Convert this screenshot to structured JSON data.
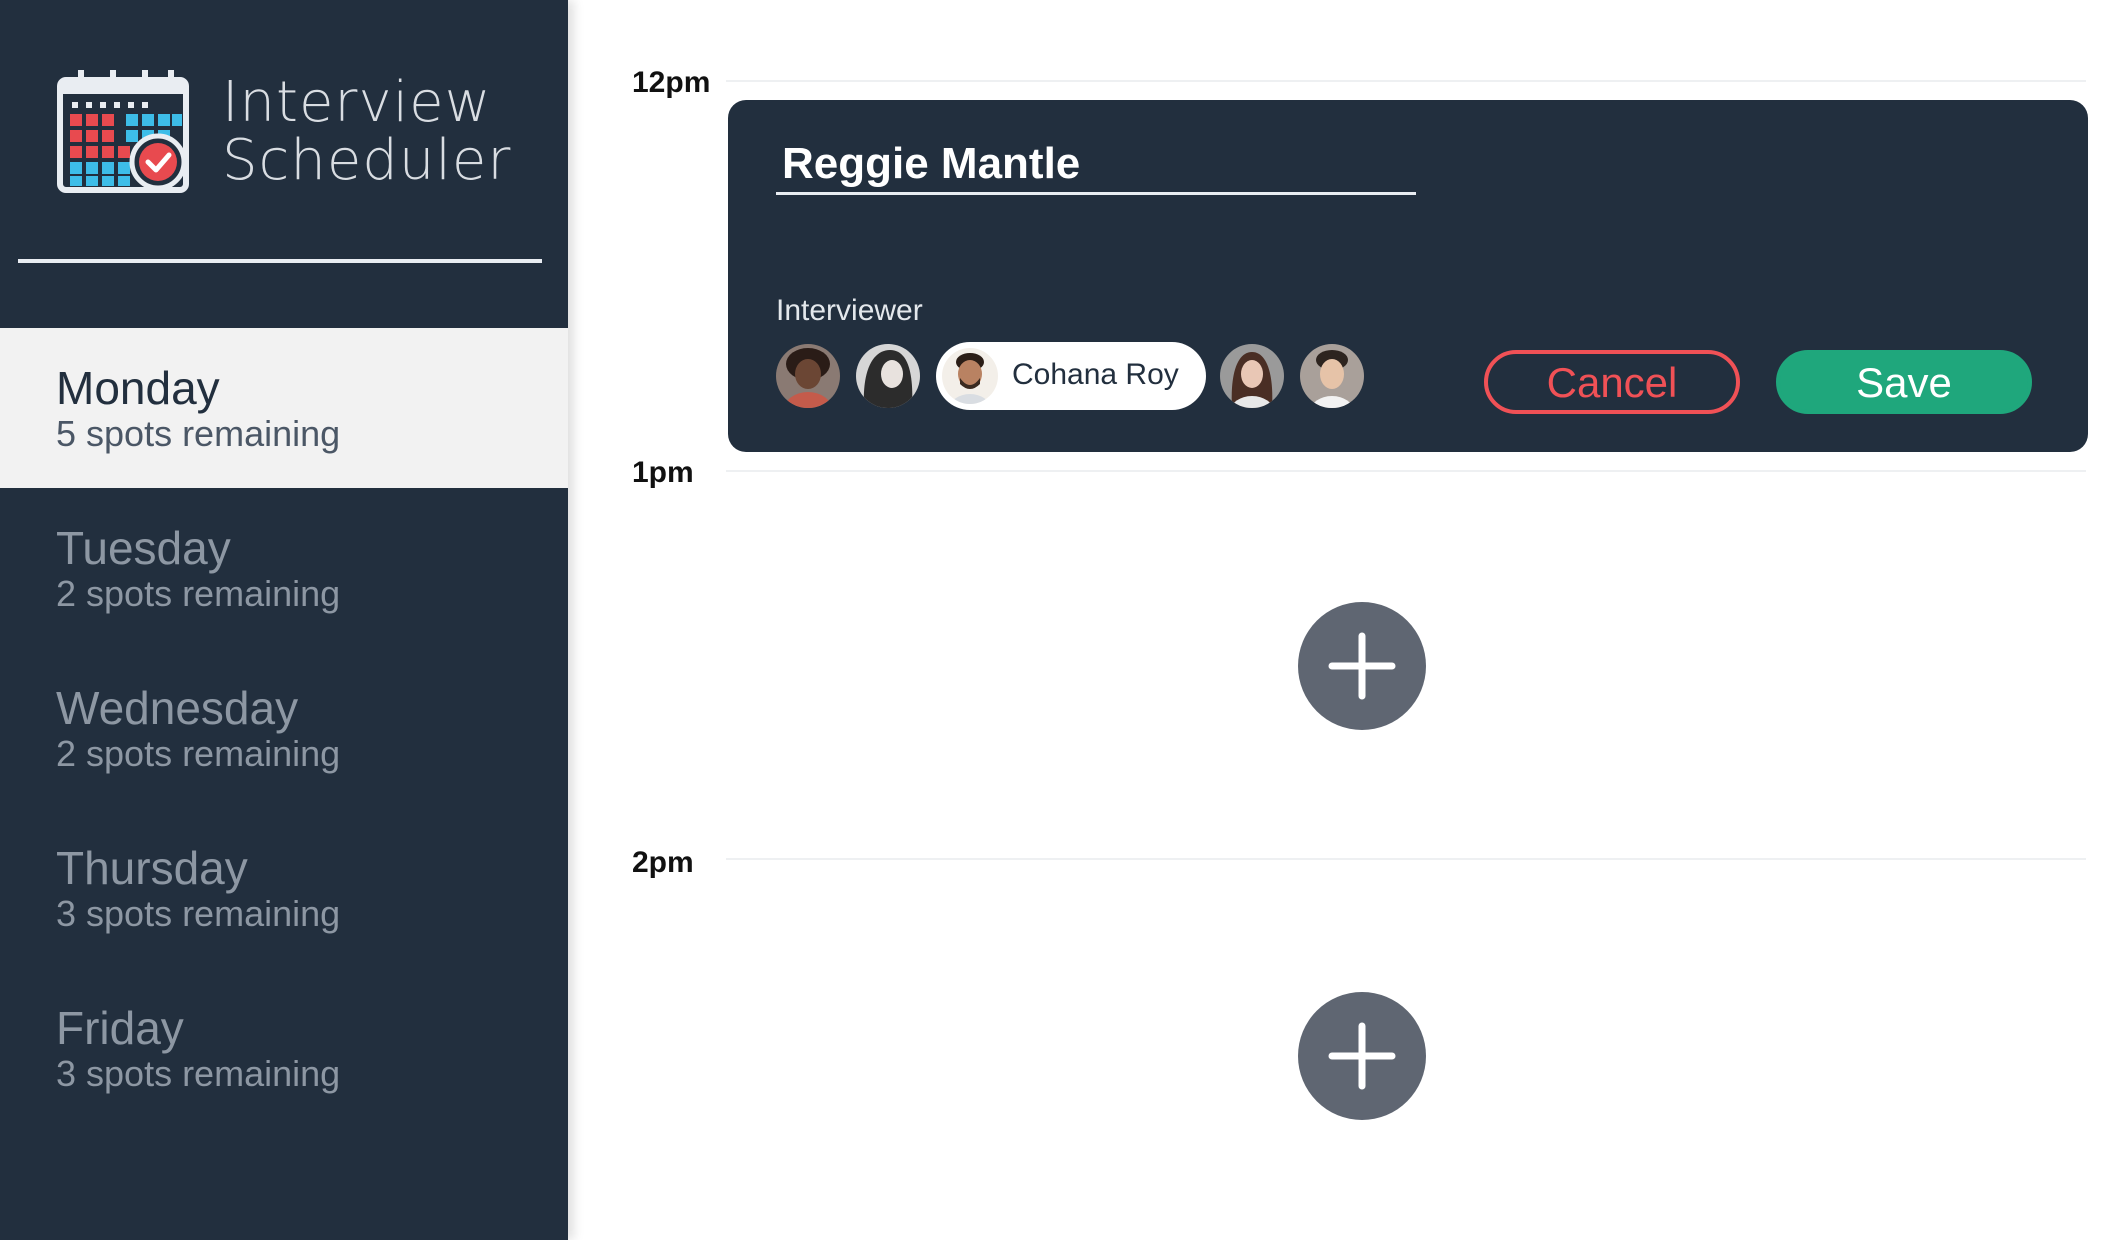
{
  "app": {
    "title_line1": "Interview",
    "title_line2": "Scheduler"
  },
  "days": [
    {
      "name": "Monday",
      "spots": "5 spots remaining",
      "selected": true
    },
    {
      "name": "Tuesday",
      "spots": "2 spots remaining",
      "selected": false
    },
    {
      "name": "Wednesday",
      "spots": "2 spots remaining",
      "selected": false
    },
    {
      "name": "Thursday",
      "spots": "3 spots remaining",
      "selected": false
    },
    {
      "name": "Friday",
      "spots": "3 spots remaining",
      "selected": false
    }
  ],
  "schedule": {
    "times": [
      "12pm",
      "1pm",
      "2pm"
    ],
    "form": {
      "student_name": "Reggie Mantle",
      "interviewer_label": "Interviewer",
      "selected_interviewer": "Cohana Roy",
      "cancel_label": "Cancel",
      "save_label": "Save"
    }
  },
  "colors": {
    "sidebar_bg": "#222f3e",
    "selected_day_bg": "#f2f2f2",
    "cancel": "#f05156",
    "save": "#1fa77c",
    "add_button": "#5f6672"
  },
  "icons": {
    "logo": "calendar-check-icon",
    "add": "plus-icon"
  }
}
